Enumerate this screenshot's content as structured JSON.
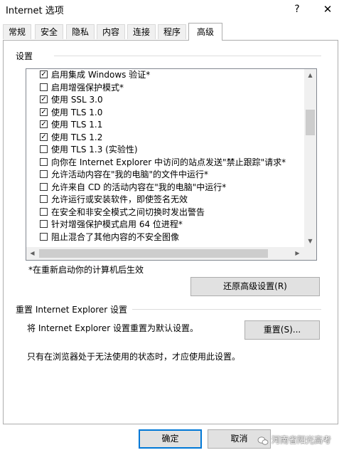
{
  "window": {
    "title": "Internet 选项",
    "help_label": "?",
    "close_label": "✕"
  },
  "tabs": [
    {
      "label": "常规"
    },
    {
      "label": "安全"
    },
    {
      "label": "隐私"
    },
    {
      "label": "内容"
    },
    {
      "label": "连接"
    },
    {
      "label": "程序"
    },
    {
      "label": "高级",
      "active": true
    }
  ],
  "settings": {
    "group_label": "设置",
    "items": [
      {
        "label": "启用集成 Windows 验证*",
        "checked": true
      },
      {
        "label": "启用增强保护模式*",
        "checked": false
      },
      {
        "label": "使用 SSL 3.0",
        "checked": true
      },
      {
        "label": "使用 TLS 1.0",
        "checked": true
      },
      {
        "label": "使用 TLS 1.1",
        "checked": true
      },
      {
        "label": "使用 TLS 1.2",
        "checked": true
      },
      {
        "label": "使用 TLS 1.3 (实验性)",
        "checked": false
      },
      {
        "label": "向你在 Internet Explorer 中访问的站点发送\"禁止跟踪\"请求*",
        "checked": false
      },
      {
        "label": "允许活动内容在\"我的电脑\"的文件中运行*",
        "checked": false
      },
      {
        "label": "允许来自 CD 的活动内容在\"我的电脑\"中运行*",
        "checked": false
      },
      {
        "label": "允许运行或安装软件，即使签名无效",
        "checked": false
      },
      {
        "label": "在安全和非安全模式之间切换时发出警告",
        "checked": false
      },
      {
        "label": "针对增强保护模式启用 64 位进程*",
        "checked": false
      },
      {
        "label": "阻止混合了其他内容的不安全图像",
        "checked": false
      }
    ],
    "restart_note": "*在重新启动你的计算机后生效",
    "restore_button": "还原高级设置(R)"
  },
  "reset": {
    "group_label": "重置 Internet Explorer 设置",
    "description": "将 Internet Explorer 设置重置为默认设置。",
    "reset_button": "重置(S)...",
    "warning": "只有在浏览器处于无法使用的状态时，才应使用此设置。"
  },
  "footer": {
    "ok_label": "确定",
    "cancel_label": "取消"
  },
  "watermark": {
    "text": "河南省阳光高考"
  }
}
